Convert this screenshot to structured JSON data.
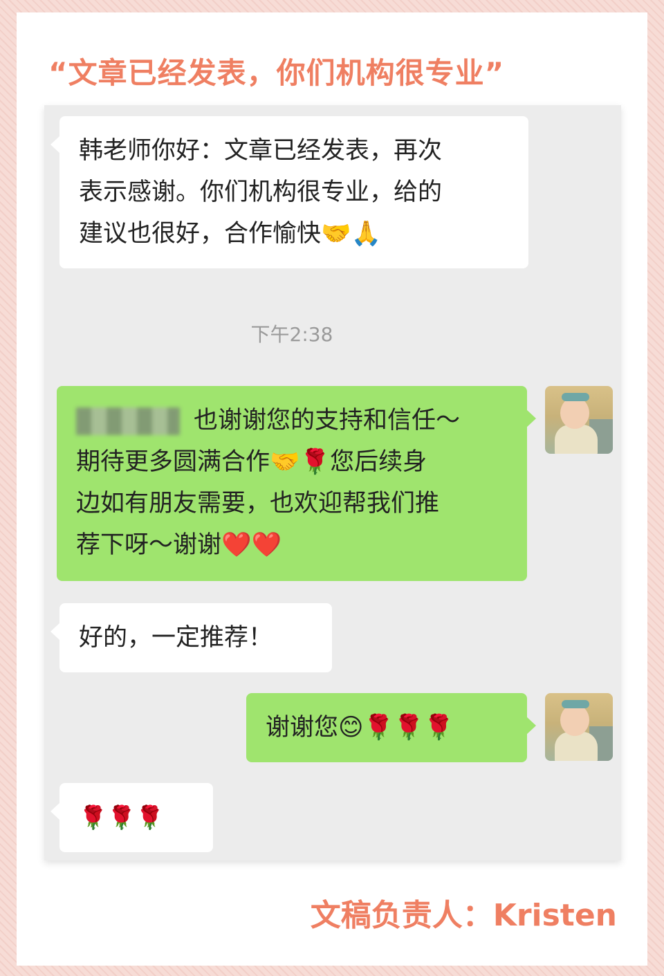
{
  "header": {
    "title": "“文章已经发表，你们机构很专业”"
  },
  "chat": {
    "messages": [
      {
        "from": "other",
        "lines": [
          "韩老师你好：文章已经发表，再次",
          "表示感谢。你们机构很专业，给的",
          "建议也很好，合作愉快🤝🙏"
        ]
      },
      {
        "type": "time",
        "text": "下午2:38"
      },
      {
        "from": "me",
        "lines": [
          "也谢谢您的支持和信任～",
          "期待更多圆满合作🤝🌹您后续身",
          "边如有朋友需要，也欢迎帮我们推",
          "荐下呀～谢谢❤️❤️"
        ]
      },
      {
        "from": "other",
        "lines": [
          "好的，一定推荐！"
        ]
      },
      {
        "from": "me",
        "lines": [
          "谢谢您😊🌹🌹🌹"
        ]
      },
      {
        "from": "other",
        "lines": [
          "🌹🌹🌹"
        ]
      }
    ]
  },
  "avatar": {
    "icon": "baby-photo-avatar"
  },
  "footer": {
    "text": "文稿负责人：Kristen"
  },
  "colors": {
    "accent": "#ef7f62",
    "out_bubble": "#9fe46e",
    "in_bubble": "#ffffff",
    "chat_bg": "#ececec"
  }
}
